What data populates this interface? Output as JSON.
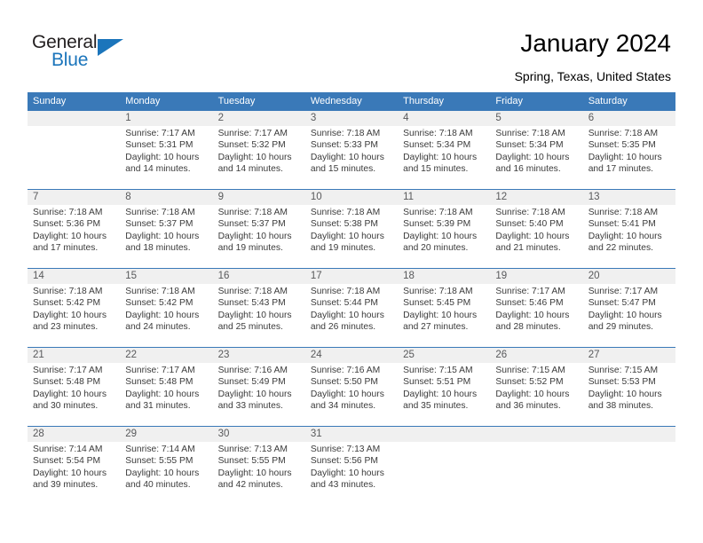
{
  "brand": {
    "name_top": "General",
    "name_bottom": "Blue",
    "accent_color": "#1b75bb"
  },
  "header": {
    "title": "January 2024",
    "subtitle": "Spring, Texas, United States"
  },
  "theme": {
    "header_blue": "#3a79b8",
    "daynum_band": "#f0f0f0",
    "text": "#3b3b3b",
    "daynum_text": "#58595b"
  },
  "weekdays": [
    "Sunday",
    "Monday",
    "Tuesday",
    "Wednesday",
    "Thursday",
    "Friday",
    "Saturday"
  ],
  "weeks": [
    [
      {
        "day": "",
        "sunrise": "",
        "sunset": "",
        "daylight1": "",
        "daylight2": "",
        "empty": true
      },
      {
        "day": "1",
        "sunrise": "Sunrise: 7:17 AM",
        "sunset": "Sunset: 5:31 PM",
        "daylight1": "Daylight: 10 hours",
        "daylight2": "and 14 minutes."
      },
      {
        "day": "2",
        "sunrise": "Sunrise: 7:17 AM",
        "sunset": "Sunset: 5:32 PM",
        "daylight1": "Daylight: 10 hours",
        "daylight2": "and 14 minutes."
      },
      {
        "day": "3",
        "sunrise": "Sunrise: 7:18 AM",
        "sunset": "Sunset: 5:33 PM",
        "daylight1": "Daylight: 10 hours",
        "daylight2": "and 15 minutes."
      },
      {
        "day": "4",
        "sunrise": "Sunrise: 7:18 AM",
        "sunset": "Sunset: 5:34 PM",
        "daylight1": "Daylight: 10 hours",
        "daylight2": "and 15 minutes."
      },
      {
        "day": "5",
        "sunrise": "Sunrise: 7:18 AM",
        "sunset": "Sunset: 5:34 PM",
        "daylight1": "Daylight: 10 hours",
        "daylight2": "and 16 minutes."
      },
      {
        "day": "6",
        "sunrise": "Sunrise: 7:18 AM",
        "sunset": "Sunset: 5:35 PM",
        "daylight1": "Daylight: 10 hours",
        "daylight2": "and 17 minutes."
      }
    ],
    [
      {
        "day": "7",
        "sunrise": "Sunrise: 7:18 AM",
        "sunset": "Sunset: 5:36 PM",
        "daylight1": "Daylight: 10 hours",
        "daylight2": "and 17 minutes."
      },
      {
        "day": "8",
        "sunrise": "Sunrise: 7:18 AM",
        "sunset": "Sunset: 5:37 PM",
        "daylight1": "Daylight: 10 hours",
        "daylight2": "and 18 minutes."
      },
      {
        "day": "9",
        "sunrise": "Sunrise: 7:18 AM",
        "sunset": "Sunset: 5:37 PM",
        "daylight1": "Daylight: 10 hours",
        "daylight2": "and 19 minutes."
      },
      {
        "day": "10",
        "sunrise": "Sunrise: 7:18 AM",
        "sunset": "Sunset: 5:38 PM",
        "daylight1": "Daylight: 10 hours",
        "daylight2": "and 19 minutes."
      },
      {
        "day": "11",
        "sunrise": "Sunrise: 7:18 AM",
        "sunset": "Sunset: 5:39 PM",
        "daylight1": "Daylight: 10 hours",
        "daylight2": "and 20 minutes."
      },
      {
        "day": "12",
        "sunrise": "Sunrise: 7:18 AM",
        "sunset": "Sunset: 5:40 PM",
        "daylight1": "Daylight: 10 hours",
        "daylight2": "and 21 minutes."
      },
      {
        "day": "13",
        "sunrise": "Sunrise: 7:18 AM",
        "sunset": "Sunset: 5:41 PM",
        "daylight1": "Daylight: 10 hours",
        "daylight2": "and 22 minutes."
      }
    ],
    [
      {
        "day": "14",
        "sunrise": "Sunrise: 7:18 AM",
        "sunset": "Sunset: 5:42 PM",
        "daylight1": "Daylight: 10 hours",
        "daylight2": "and 23 minutes."
      },
      {
        "day": "15",
        "sunrise": "Sunrise: 7:18 AM",
        "sunset": "Sunset: 5:42 PM",
        "daylight1": "Daylight: 10 hours",
        "daylight2": "and 24 minutes."
      },
      {
        "day": "16",
        "sunrise": "Sunrise: 7:18 AM",
        "sunset": "Sunset: 5:43 PM",
        "daylight1": "Daylight: 10 hours",
        "daylight2": "and 25 minutes."
      },
      {
        "day": "17",
        "sunrise": "Sunrise: 7:18 AM",
        "sunset": "Sunset: 5:44 PM",
        "daylight1": "Daylight: 10 hours",
        "daylight2": "and 26 minutes."
      },
      {
        "day": "18",
        "sunrise": "Sunrise: 7:18 AM",
        "sunset": "Sunset: 5:45 PM",
        "daylight1": "Daylight: 10 hours",
        "daylight2": "and 27 minutes."
      },
      {
        "day": "19",
        "sunrise": "Sunrise: 7:17 AM",
        "sunset": "Sunset: 5:46 PM",
        "daylight1": "Daylight: 10 hours",
        "daylight2": "and 28 minutes."
      },
      {
        "day": "20",
        "sunrise": "Sunrise: 7:17 AM",
        "sunset": "Sunset: 5:47 PM",
        "daylight1": "Daylight: 10 hours",
        "daylight2": "and 29 minutes."
      }
    ],
    [
      {
        "day": "21",
        "sunrise": "Sunrise: 7:17 AM",
        "sunset": "Sunset: 5:48 PM",
        "daylight1": "Daylight: 10 hours",
        "daylight2": "and 30 minutes."
      },
      {
        "day": "22",
        "sunrise": "Sunrise: 7:17 AM",
        "sunset": "Sunset: 5:48 PM",
        "daylight1": "Daylight: 10 hours",
        "daylight2": "and 31 minutes."
      },
      {
        "day": "23",
        "sunrise": "Sunrise: 7:16 AM",
        "sunset": "Sunset: 5:49 PM",
        "daylight1": "Daylight: 10 hours",
        "daylight2": "and 33 minutes."
      },
      {
        "day": "24",
        "sunrise": "Sunrise: 7:16 AM",
        "sunset": "Sunset: 5:50 PM",
        "daylight1": "Daylight: 10 hours",
        "daylight2": "and 34 minutes."
      },
      {
        "day": "25",
        "sunrise": "Sunrise: 7:15 AM",
        "sunset": "Sunset: 5:51 PM",
        "daylight1": "Daylight: 10 hours",
        "daylight2": "and 35 minutes."
      },
      {
        "day": "26",
        "sunrise": "Sunrise: 7:15 AM",
        "sunset": "Sunset: 5:52 PM",
        "daylight1": "Daylight: 10 hours",
        "daylight2": "and 36 minutes."
      },
      {
        "day": "27",
        "sunrise": "Sunrise: 7:15 AM",
        "sunset": "Sunset: 5:53 PM",
        "daylight1": "Daylight: 10 hours",
        "daylight2": "and 38 minutes."
      }
    ],
    [
      {
        "day": "28",
        "sunrise": "Sunrise: 7:14 AM",
        "sunset": "Sunset: 5:54 PM",
        "daylight1": "Daylight: 10 hours",
        "daylight2": "and 39 minutes."
      },
      {
        "day": "29",
        "sunrise": "Sunrise: 7:14 AM",
        "sunset": "Sunset: 5:55 PM",
        "daylight1": "Daylight: 10 hours",
        "daylight2": "and 40 minutes."
      },
      {
        "day": "30",
        "sunrise": "Sunrise: 7:13 AM",
        "sunset": "Sunset: 5:55 PM",
        "daylight1": "Daylight: 10 hours",
        "daylight2": "and 42 minutes."
      },
      {
        "day": "31",
        "sunrise": "Sunrise: 7:13 AM",
        "sunset": "Sunset: 5:56 PM",
        "daylight1": "Daylight: 10 hours",
        "daylight2": "and 43 minutes."
      },
      {
        "day": "",
        "sunrise": "",
        "sunset": "",
        "daylight1": "",
        "daylight2": "",
        "empty": true
      },
      {
        "day": "",
        "sunrise": "",
        "sunset": "",
        "daylight1": "",
        "daylight2": "",
        "empty": true
      },
      {
        "day": "",
        "sunrise": "",
        "sunset": "",
        "daylight1": "",
        "daylight2": "",
        "empty": true
      }
    ]
  ]
}
